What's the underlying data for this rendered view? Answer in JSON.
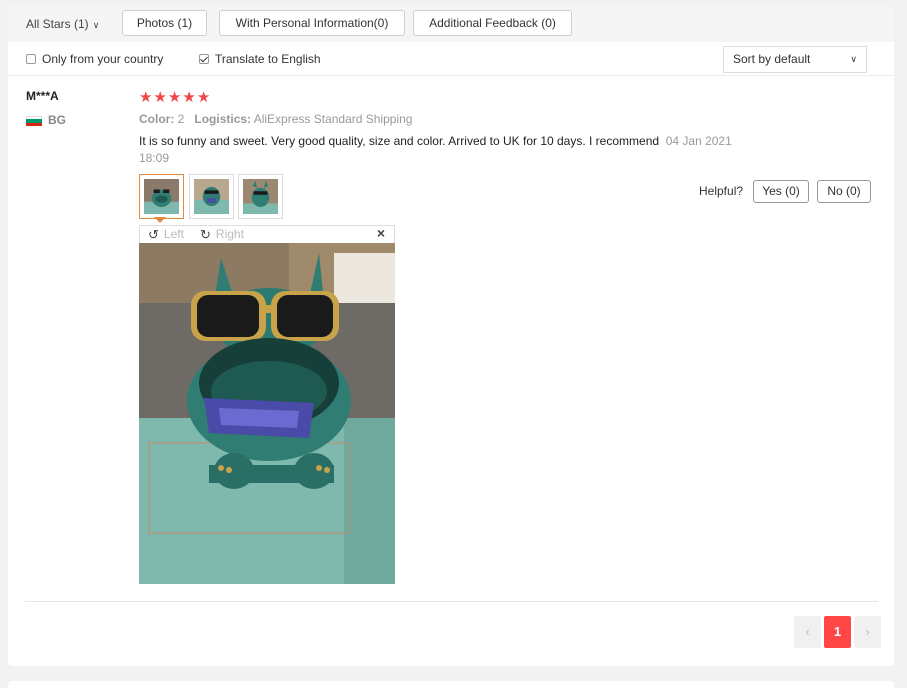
{
  "filters": {
    "stars_label": "All Stars (1)",
    "photos_label": "Photos (1)",
    "personal_info_label": "With Personal Information(0)",
    "additional_feedback_label": "Additional Feedback (0)"
  },
  "options": {
    "only_country_label": "Only from your country",
    "only_country_checked": false,
    "translate_label": "Translate to English",
    "translate_checked": true,
    "sort_label": "Sort by default"
  },
  "review": {
    "user": "M***A",
    "country": "BG",
    "rating": 5,
    "color_key": "Color:",
    "color_value": "2",
    "logistics_key": "Logistics:",
    "logistics_value": "AliExpress Standard Shipping",
    "text": "It is so funny and sweet. Very good quality, size and color. Arrived to UK for 10 days. I recommend",
    "date": "04 Jan 2021",
    "time": "18:09",
    "photo_count": 3,
    "helpful_label": "Helpful?",
    "yes_label": "Yes (0)",
    "no_label": "No (0)"
  },
  "viewer": {
    "rotate_left_label": "Left",
    "rotate_right_label": "Right",
    "close_symbol": "×"
  },
  "pagination": {
    "prev_symbol": "‹",
    "current_page": "1",
    "next_symbol": "›"
  },
  "colors": {
    "accent_red": "#ff4747",
    "star_red": "#f0474d",
    "thumb_active_border": "#e58a3a",
    "flag_white": "#ffffff",
    "flag_green": "#00966e",
    "flag_red": "#d62612",
    "figure_teal": "#2f7d73"
  }
}
